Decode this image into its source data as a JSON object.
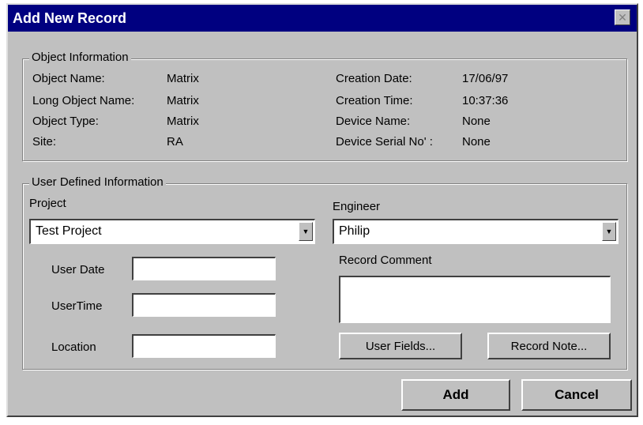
{
  "window": {
    "title": "Add New Record",
    "close_glyph": "✕"
  },
  "object_info": {
    "legend": "Object Information",
    "left": [
      {
        "label": "Object Name:",
        "value": "Matrix"
      },
      {
        "label": "Long Object Name:",
        "value": "Matrix"
      },
      {
        "label": "Object Type:",
        "value": "Matrix"
      },
      {
        "label": "Site:",
        "value": "RA"
      }
    ],
    "right": [
      {
        "label": "Creation Date:",
        "value": "17/06/97"
      },
      {
        "label": "Creation Time:",
        "value": "10:37:36"
      },
      {
        "label": "Device Name:",
        "value": "None"
      },
      {
        "label": "Device Serial No' :",
        "value": "None"
      }
    ]
  },
  "user_info": {
    "legend": "User Defined Information",
    "project_label": "Project",
    "project_value": "Test Project",
    "engineer_label": "Engineer",
    "engineer_value": "Philip",
    "user_date_label": "User Date",
    "user_date_value": "",
    "user_time_label": "UserTime",
    "user_time_value": "",
    "location_label": "Location",
    "location_value": "",
    "record_comment_label": "Record Comment",
    "record_comment_value": "",
    "user_fields_button": "User Fields...",
    "record_note_button": "Record Note..."
  },
  "footer": {
    "add_button": "Add",
    "cancel_button": "Cancel"
  },
  "icons": {
    "dropdown": "▼"
  }
}
